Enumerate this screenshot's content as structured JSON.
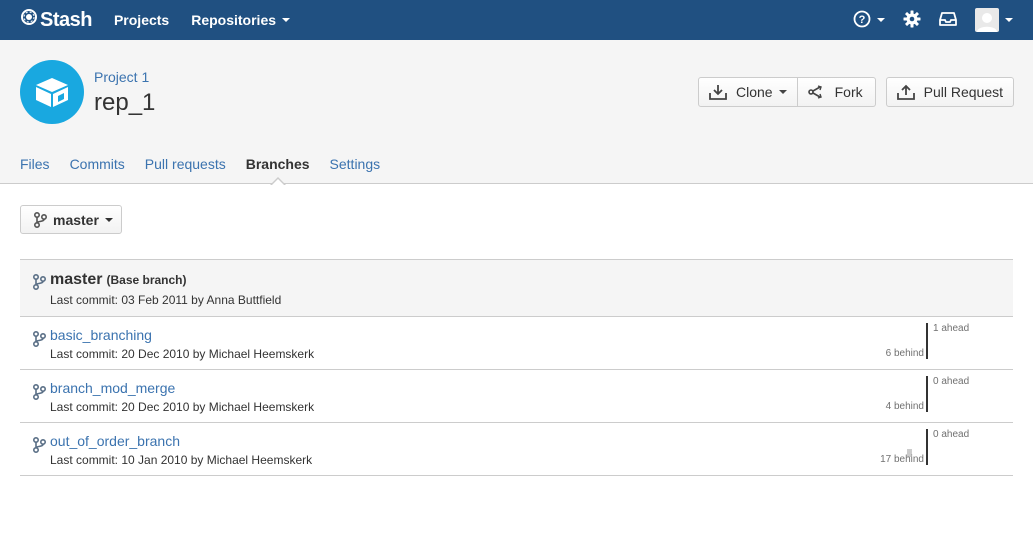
{
  "nav": {
    "brand": "Stash",
    "projects": "Projects",
    "repositories": "Repositories"
  },
  "repo": {
    "project": "Project 1",
    "name": "rep_1"
  },
  "actions": {
    "clone": "Clone",
    "fork": "Fork",
    "pull_request": "Pull Request"
  },
  "tabs": [
    "Files",
    "Commits",
    "Pull requests",
    "Branches",
    "Settings"
  ],
  "active_tab": "Branches",
  "branch_selector": {
    "label": "master"
  },
  "base_branch": {
    "name": "master",
    "tag": "(Base branch)",
    "commit": "Last commit: 03 Feb 2011 by Anna Buttfield"
  },
  "branches": [
    {
      "name": "basic_branching",
      "commit": "Last commit: 20 Dec 2010 by Michael Heemskerk",
      "ahead": "1 ahead",
      "behind": "6 behind"
    },
    {
      "name": "branch_mod_merge",
      "commit": "Last commit: 20 Dec 2010 by Michael Heemskerk",
      "ahead": "0 ahead",
      "behind": "4 behind"
    },
    {
      "name": "out_of_order_branch",
      "commit": "Last commit: 10 Jan 2010 by Michael Heemskerk",
      "ahead": "0 ahead",
      "behind": "17 behind"
    }
  ],
  "colors": {
    "nav_bg": "#205081",
    "link": "#3b73af",
    "repo_avatar": "#19a8e0"
  },
  "icons": [
    "stash-logo-icon",
    "help-icon",
    "gear-icon",
    "inbox-icon",
    "user-avatar-icon",
    "repo-box-icon",
    "download-icon",
    "fork-icon",
    "upload-icon",
    "branch-icon"
  ]
}
